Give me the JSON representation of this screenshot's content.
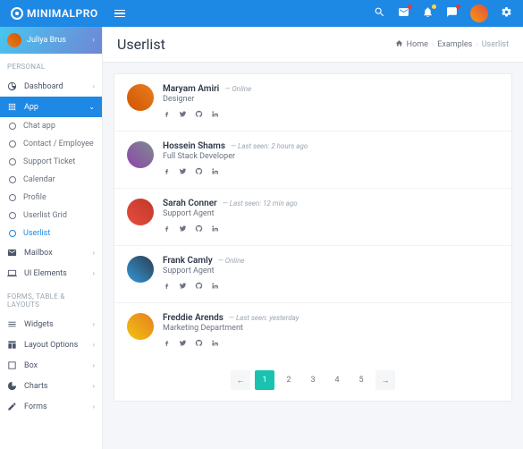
{
  "brand": {
    "name": "MINIMALPRO"
  },
  "user": {
    "name": "Juliya Brus"
  },
  "sections": {
    "personal": "PERSONAL",
    "forms": "FORMS, TABLE & LAYOUTS"
  },
  "nav": {
    "dashboard": "Dashboard",
    "app": "App",
    "mailbox": "Mailbox",
    "ui": "UI Elements",
    "widgets": "Widgets",
    "layout": "Layout Options",
    "box": "Box",
    "charts": "Charts",
    "forms": "Forms"
  },
  "sub": {
    "chat": "Chat app",
    "contact": "Contact / Employee",
    "ticket": "Support Ticket",
    "calendar": "Calendar",
    "profile": "Profile",
    "grid": "Userlist Grid",
    "userlist": "Userlist"
  },
  "page": {
    "title": "Userlist"
  },
  "breadcrumb": {
    "home": "Home",
    "mid": "Examples",
    "cur": "Userlist"
  },
  "users": [
    {
      "name": "Maryam Amiri",
      "status": "— Online",
      "role": "Designer"
    },
    {
      "name": "Hossein Shams",
      "status": "— Last seen: 2 hours ago",
      "role": "Full Stack Developer"
    },
    {
      "name": "Sarah Conner",
      "status": "— Last seen: 12 min ago",
      "role": "Support Agent"
    },
    {
      "name": "Frank Camly",
      "status": "— Online",
      "role": "Support Agent"
    },
    {
      "name": "Freddie Arends",
      "status": "— Last seen: yesterday",
      "role": "Marketing Department"
    }
  ],
  "pagination": {
    "prev": "←",
    "p1": "1",
    "p2": "2",
    "p3": "3",
    "p4": "4",
    "p5": "5",
    "next": "→"
  }
}
